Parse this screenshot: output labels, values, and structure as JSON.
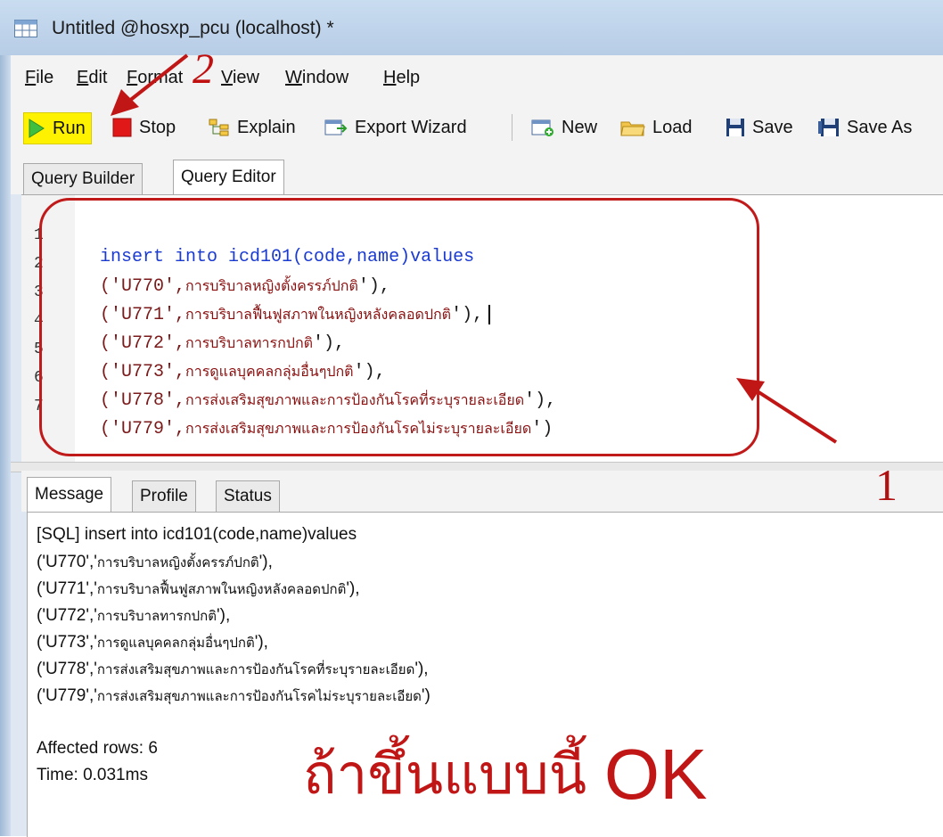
{
  "window": {
    "title": "Untitled @hosxp_pcu (localhost) *"
  },
  "menu": [
    {
      "label": "File"
    },
    {
      "label": "Edit"
    },
    {
      "label": "Format"
    },
    {
      "label": "View"
    },
    {
      "label": "Window"
    },
    {
      "label": "Help"
    }
  ],
  "toolbar": {
    "run": "Run",
    "stop": "Stop",
    "explain": "Explain",
    "export": "Export Wizard",
    "new": "New",
    "load": "Load",
    "save": "Save",
    "save_as": "Save As"
  },
  "editor_tabs": [
    {
      "label": "Query Builder"
    },
    {
      "label": "Query Editor"
    }
  ],
  "code_lines": [
    {
      "n": "1",
      "kw": "insert into",
      "rest": " icd101(code,name)values"
    },
    {
      "n": "2",
      "code": "('U770',",
      "thai": "การบริบาลหญิงตั้งครรภ์ปกติ",
      "tail": "'),"
    },
    {
      "n": "3",
      "code": "('U771',",
      "thai": "การบริบาลฟื้นฟูสภาพในหญิงหลังคลอดปกติ",
      "tail": "'),"
    },
    {
      "n": "4",
      "code": "('U772',",
      "thai": "การบริบาลทารกปกติ",
      "tail": "'),"
    },
    {
      "n": "5",
      "code": "('U773',",
      "thai": "การดูแลบุคคลกลุ่มอื่นๆปกติ",
      "tail": "'),"
    },
    {
      "n": "6",
      "code": "('U778',",
      "thai": "การส่งเสริมสุขภาพและการป้องกันโรคที่ระบุรายละเอียด",
      "tail": "'),"
    },
    {
      "n": "7",
      "code": "('U779',",
      "thai": "การส่งเสริมสุขภาพและการป้องกันโรคไม่ระบุรายละเอียด",
      "tail": "')"
    }
  ],
  "annotations": {
    "one": "1",
    "two": "2",
    "ok_thai": "ถ้าขึ้นแบบนี้",
    "ok_latin": "OK"
  },
  "result_tabs": [
    {
      "label": "Message"
    },
    {
      "label": "Profile"
    },
    {
      "label": "Status"
    }
  ],
  "message": {
    "sql_line": "[SQL] insert into icd101(code,name)values",
    "rows": [
      {
        "code": "('U770','",
        "thai": "การบริบาลหญิงตั้งครรภ์ปกติ",
        "tail": "'),"
      },
      {
        "code": "('U771','",
        "thai": "การบริบาลฟื้นฟูสภาพในหญิงหลังคลอดปกติ",
        "tail": "'),"
      },
      {
        "code": "('U772','",
        "thai": "การบริบาลทารกปกติ",
        "tail": "'),"
      },
      {
        "code": "('U773','",
        "thai": "การดูแลบุคคลกลุ่มอื่นๆปกติ",
        "tail": "'),"
      },
      {
        "code": "('U778','",
        "thai": "การส่งเสริมสุขภาพและการป้องกันโรคที่ระบุรายละเอียด",
        "tail": "'),"
      },
      {
        "code": "('U779','",
        "thai": "การส่งเสริมสุขภาพและการป้องกันโรคไม่ระบุรายละเอียด",
        "tail": "')"
      }
    ],
    "affected": "Affected rows: 6",
    "time": "Time: 0.031ms"
  }
}
